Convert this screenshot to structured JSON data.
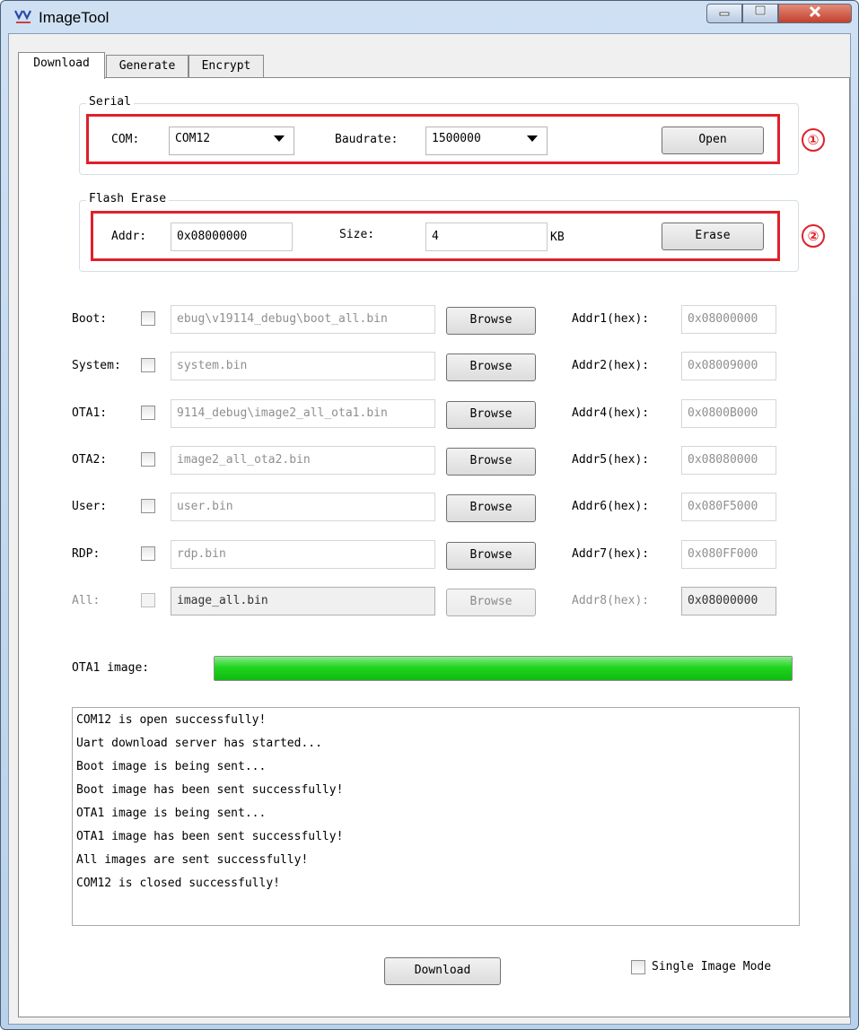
{
  "window": {
    "title": "ImageTool",
    "app_icon": "imagetool-app-icon",
    "controls": [
      "minimize-icon",
      "maximize-icon",
      "close-icon"
    ]
  },
  "tabs": [
    {
      "label": "Download",
      "active": true
    },
    {
      "label": "Generate",
      "active": false
    },
    {
      "label": "Encrypt",
      "active": false
    }
  ],
  "serial": {
    "group_label": "Serial",
    "com_label": "COM:",
    "com_value": "COM12",
    "baudrate_label": "Baudrate:",
    "baudrate_value": "1500000",
    "open_label": "Open",
    "annotation": "①"
  },
  "flash_erase": {
    "group_label": "Flash Erase",
    "addr_label": "Addr:",
    "addr_value": "0x08000000",
    "size_label": "Size:",
    "size_value": "4",
    "size_unit": "KB",
    "erase_label": "Erase",
    "annotation": "②"
  },
  "images": [
    {
      "label": "Boot:",
      "path": "ebug\\v19114_debug\\boot_all.bin",
      "browse": "Browse",
      "addr_label": "Addr1(hex):",
      "addr": "0x08000000",
      "enabled": true,
      "checked": false
    },
    {
      "label": "System:",
      "path": "system.bin",
      "browse": "Browse",
      "addr_label": "Addr2(hex):",
      "addr": "0x08009000",
      "enabled": true,
      "checked": false
    },
    {
      "label": "OTA1:",
      "path": "9114_debug\\image2_all_ota1.bin",
      "browse": "Browse",
      "addr_label": "Addr4(hex):",
      "addr": "0x0800B000",
      "enabled": true,
      "checked": false
    },
    {
      "label": "OTA2:",
      "path": "image2_all_ota2.bin",
      "browse": "Browse",
      "addr_label": "Addr5(hex):",
      "addr": "0x08080000",
      "enabled": true,
      "checked": false
    },
    {
      "label": "User:",
      "path": "user.bin",
      "browse": "Browse",
      "addr_label": "Addr6(hex):",
      "addr": "0x080F5000",
      "enabled": true,
      "checked": false
    },
    {
      "label": "RDP:",
      "path": "rdp.bin",
      "browse": "Browse",
      "addr_label": "Addr7(hex):",
      "addr": "0x080FF000",
      "enabled": true,
      "checked": false
    },
    {
      "label": "All:",
      "path": "image_all.bin",
      "browse": "Browse",
      "addr_label": "Addr8(hex):",
      "addr": "0x08000000",
      "enabled": false,
      "checked": false
    }
  ],
  "progress": {
    "label": "OTA1 image:",
    "percent": 100,
    "color": "#1fd61f"
  },
  "log": {
    "lines": [
      "COM12 is open successfully!",
      "Uart download server has started...",
      "Boot image is being sent...",
      "Boot image has been sent successfully!",
      "OTA1 image is being sent...",
      "OTA1 image has been sent successfully!",
      "All images are sent successfully!",
      "COM12 is closed successfully!"
    ]
  },
  "footer": {
    "download_label": "Download",
    "single_image_label": "Single Image Mode",
    "single_image_checked": false
  },
  "colors": {
    "annotation_red": "#e0202a",
    "progress_green": "#1fd61f",
    "close_button_red": "#c3412d"
  }
}
